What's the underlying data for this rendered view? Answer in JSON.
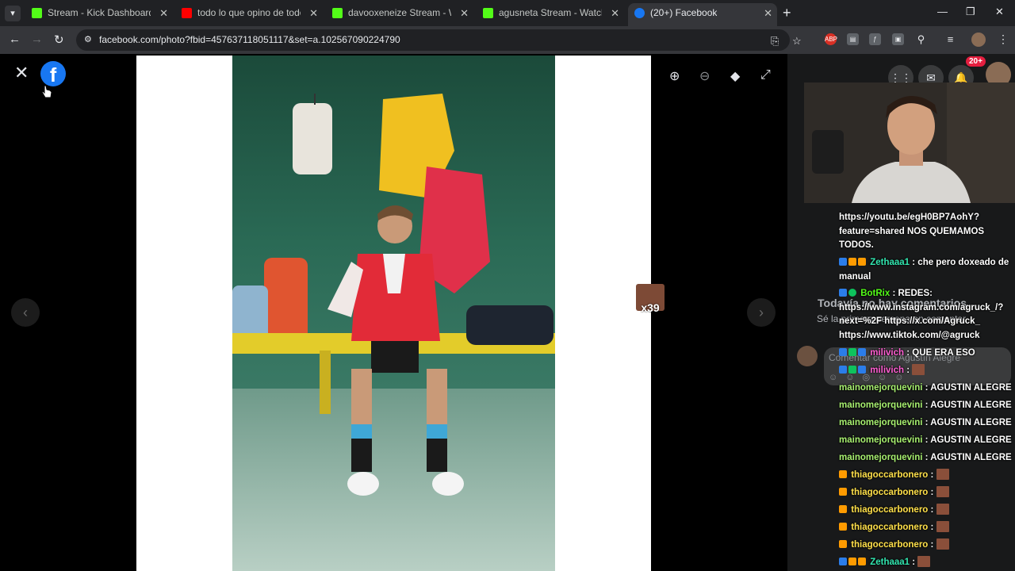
{
  "browser": {
    "tabs": [
      {
        "title": "Stream - Kick Dashboard",
        "favicon": "kick-icon",
        "active": false
      },
      {
        "title": "todo lo que opino de todos los",
        "favicon": "youtube-icon",
        "active": false
      },
      {
        "title": "davooxeneize Stream - Watch L",
        "favicon": "kick-icon",
        "active": false
      },
      {
        "title": "agusneta Stream - Watch Live c",
        "favicon": "kick-icon",
        "active": false
      },
      {
        "title": "(20+) Facebook",
        "favicon": "facebook-icon",
        "active": true
      }
    ],
    "url": "facebook.com/photo?fbid=457637118051117&set=a.102567090224790"
  },
  "viewer": {
    "tools": [
      "zoom-in-icon",
      "zoom-out-icon",
      "tag-icon",
      "fullscreen-icon"
    ],
    "emote_overlay_count": "x39"
  },
  "facebook_panel": {
    "notification_count": "20+",
    "no_comments_title": "Todavía no hay comentarios",
    "be_first": "Sé la primera persona en comentar.",
    "comment_placeholder": "Comentar como Agustín Alegre"
  },
  "chat": {
    "messages": [
      {
        "user": "",
        "text": "https://youtu.be/egH0BP7AohY?feature=shared NOS QUEMAMOS TODOS."
      },
      {
        "user": "Zethaaa1",
        "sep": " : ",
        "text": "che pero doxeado de manual"
      },
      {
        "user": "BotRix",
        "sep": " : ",
        "text": "REDES: https://www.instagram.com/agruck_/?next=%2F https://x.com/Agruck_ https://www.tiktok.com/@agruck"
      },
      {
        "user": "milivich",
        "sep": " : ",
        "text": "QUE ERA ESO"
      },
      {
        "user": "milivich",
        "sep": " : ",
        "text": ""
      },
      {
        "user": "mainomejorquevini",
        "sep": " : ",
        "text": "AGUSTIN ALEGRE"
      },
      {
        "user": "mainomejorquevini",
        "sep": " : ",
        "text": "AGUSTIN ALEGRE"
      },
      {
        "user": "mainomejorquevini",
        "sep": " : ",
        "text": "AGUSTIN ALEGRE"
      },
      {
        "user": "mainomejorquevini",
        "sep": " : ",
        "text": "AGUSTIN ALEGRE"
      },
      {
        "user": "mainomejorquevini",
        "sep": " : ",
        "text": "AGUSTIN ALEGRE"
      },
      {
        "user": "thiagoccarbonero",
        "sep": " : ",
        "text": ""
      },
      {
        "user": "thiagoccarbonero",
        "sep": " : ",
        "text": ""
      },
      {
        "user": "thiagoccarbonero",
        "sep": " : ",
        "text": ""
      },
      {
        "user": "thiagoccarbonero",
        "sep": " : ",
        "text": ""
      },
      {
        "user": "thiagoccarbonero",
        "sep": " : ",
        "text": ""
      },
      {
        "user": "Zethaaa1",
        "sep": " : ",
        "text": ""
      }
    ]
  },
  "colors": {
    "facebook_blue": "#1877f2",
    "kick_green": "#53fc18",
    "panel_bg": "#18191a"
  }
}
